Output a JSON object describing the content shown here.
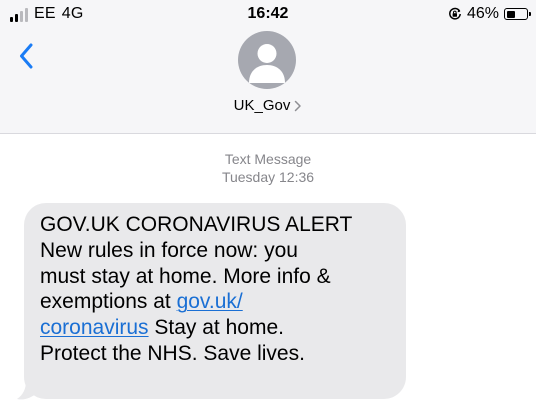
{
  "status_bar": {
    "carrier": "EE",
    "network": "4G",
    "time": "16:42",
    "battery_percent": "46%",
    "battery_level": 0.46,
    "signal_bars_active": 2,
    "signal_bars_total": 4,
    "icons": [
      "signal-icon",
      "rotation-lock-icon",
      "battery-icon"
    ]
  },
  "header": {
    "back_icon": "chevron-left-icon",
    "avatar_icon": "person-silhouette-icon",
    "contact_name": "UK_Gov",
    "contact_chevron": "chevron-right-icon"
  },
  "conversation": {
    "service": "Text Message",
    "timestamp": "Tuesday 12:36",
    "message": {
      "line1": "GOV.UK CORONAVIRUS ALERT",
      "line2": "New rules in force now: you",
      "line3": "must stay at home. More info &",
      "line4_text": "exemptions at ",
      "link_part1": "gov.uk/",
      "link_part2": "coronavirus",
      "line5_text": " Stay at home.",
      "line6": "Protect the NHS. Save lives."
    }
  },
  "colors": {
    "header_bg": "#f6f6f8",
    "bubble_bg": "#e9e9eb",
    "link": "#1a6fd4",
    "accent_blue": "#1a7cf5",
    "meta_gray": "#86868b",
    "avatar_gray": "#a6a8b0"
  }
}
